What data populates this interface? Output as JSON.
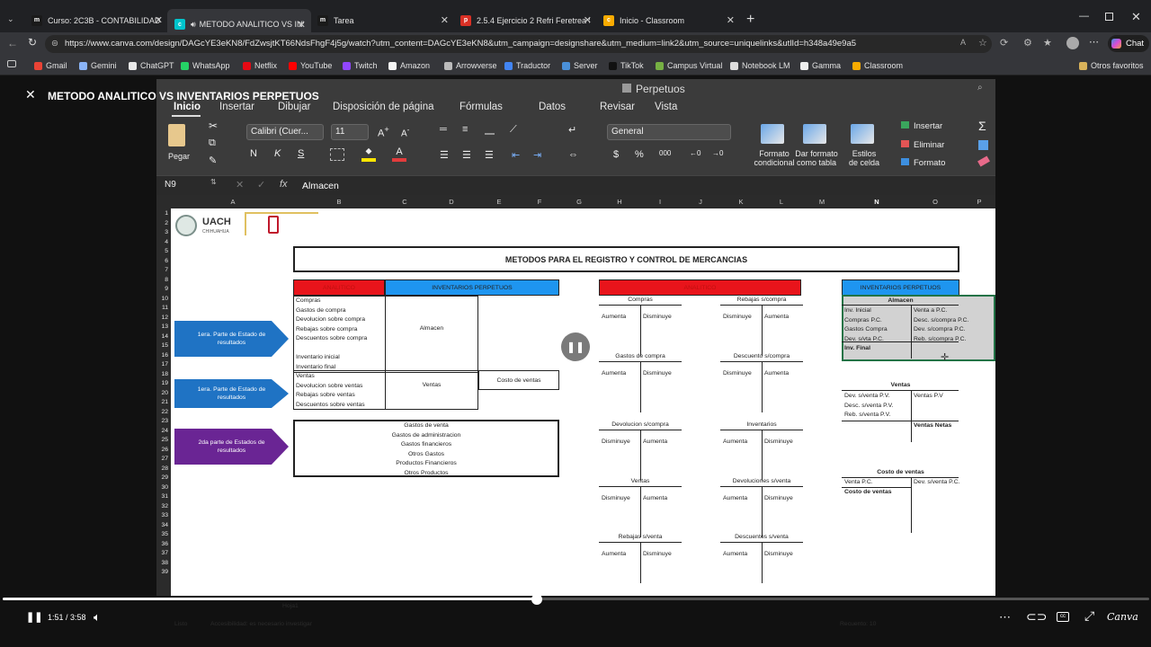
{
  "browser": {
    "tabs": [
      {
        "title": "Curso: 2C3B - CONTABILIDAD II - S",
        "fav": "m",
        "favcolor": "#1a1a1a"
      },
      {
        "title": "METODO ANALITICO VS INVE",
        "fav": "c",
        "favcolor": "#00c4cc"
      },
      {
        "title": "Tarea",
        "fav": "m",
        "favcolor": "#1a1a1a"
      },
      {
        "title": "2.5.4 Ejercicio 2 Refri Feretrea S.A",
        "fav": "p",
        "favcolor": "#d93025"
      },
      {
        "title": "Inicio - Classroom",
        "fav": "c",
        "favcolor": "#f9ab00"
      }
    ],
    "new_tab": "+",
    "url": "https://www.canva.com/design/DAGcYE3eKN8/FdZwsjtKT66NdsFhgF4j5g/watch?utm_content=DAGcYE3eKN8&utm_campaign=designshare&utm_medium=link2&utm_source=uniquelinks&utlId=h348a49e9a5",
    "chat_label": "Chat",
    "bookmarks": [
      {
        "label": "Gmail",
        "color": "#ea4335"
      },
      {
        "label": "Gemini",
        "color": "#8ab4f8"
      },
      {
        "label": "ChatGPT",
        "color": "#e8e8e8"
      },
      {
        "label": "WhatsApp",
        "color": "#25d366"
      },
      {
        "label": "Netflix",
        "color": "#e50914"
      },
      {
        "label": "YouTube",
        "color": "#ff0000"
      },
      {
        "label": "Twitch",
        "color": "#9146ff"
      },
      {
        "label": "Amazon",
        "color": "#f5f5f5"
      },
      {
        "label": "Arrowverse",
        "color": "#bbbbbb"
      },
      {
        "label": "Traductor",
        "color": "#4285f4"
      },
      {
        "label": "Server",
        "color": "#4a90d9"
      },
      {
        "label": "TikTok",
        "color": "#111111"
      },
      {
        "label": "Campus Virtual",
        "color": "#76b043"
      },
      {
        "label": "Notebook LM",
        "color": "#dddddd"
      },
      {
        "label": "Gamma",
        "color": "#eeeeee"
      },
      {
        "label": "Classroom",
        "color": "#f9ab00"
      }
    ],
    "other_favorites": "Otros favoritos"
  },
  "player": {
    "title": "METODO ANALITICO VS INVENTARIOS PERPETUOS",
    "time": "1:51 / 3:58",
    "progress": 0.466,
    "brand": "Canva",
    "blurred_status": "Listo",
    "blurred_accessibility": "Accesibilidad: es necesario investigar",
    "blurred_count": "Recuento: 10"
  },
  "excel": {
    "filename": "Perpetuos",
    "tabs": [
      "Inicio",
      "Insertar",
      "Dibujar",
      "Disposición de página",
      "Fórmulas",
      "Datos",
      "Revisar",
      "Vista"
    ],
    "paste": "Pegar",
    "font": "Calibri (Cuer...",
    "size": "11",
    "font_buttons": [
      "N",
      "K",
      "S"
    ],
    "number_format": "General",
    "num_symbols": [
      "$",
      "%",
      "000"
    ],
    "styles": [
      {
        "l1": "Formato",
        "l2": "condicional"
      },
      {
        "l1": "Dar formato",
        "l2": "como tabla"
      },
      {
        "l1": "Estilos",
        "l2": "de celda"
      }
    ],
    "cells_group": [
      "Insertar",
      "Eliminar",
      "Formato"
    ],
    "namebox": "N9",
    "formula": "Almacen",
    "columns": [
      "A",
      "B",
      "C",
      "D",
      "E",
      "F",
      "G",
      "H",
      "I",
      "J",
      "K",
      "L",
      "M",
      "N",
      "O",
      "P"
    ],
    "rows": [
      "1",
      "2",
      "3",
      "4",
      "5",
      "6",
      "7",
      "8",
      "9",
      "10",
      "11",
      "12",
      "13",
      "14",
      "15",
      "16",
      "17",
      "18",
      "19",
      "20",
      "21",
      "22",
      "23",
      "24",
      "25",
      "26",
      "27",
      "28",
      "29",
      "30",
      "31",
      "32",
      "33",
      "34",
      "35",
      "36",
      "37",
      "38",
      "39"
    ],
    "logo_uach": "UACH",
    "logo_uach_sub": "CHIHUAHUA",
    "main_title": "METODOS PARA EL REGISTRO Y CONTROL DE MERCANCIAS",
    "hdr_analitico": "ANALITICO",
    "hdr_perpetuos": "INVENTARIOS PERPETUOS",
    "arrows": [
      "1era. Parte de Estado de resultados",
      "1era. Parte de Estado de resultados",
      "2da parte de Estados de resultados"
    ],
    "list_a": [
      "Compras",
      "Gastos de compra",
      "Devolucion sobre compra",
      "Rebajas sobre compra",
      "Descuentos sobre compra",
      "",
      "Inventario inicial",
      "Inventario final"
    ],
    "almacen": "Almacen",
    "list_b": [
      "Ventas",
      "Devolucion sobre ventas",
      "Rebajas sobre ventas",
      "Descuentos sobre ventas"
    ],
    "ventas": "Ventas",
    "costo_ventas": "Costo de ventas",
    "list_c": [
      "Gastos de venta",
      "Gastos de administracion",
      "Gastos financieros",
      "Otros Gastos",
      "Productos Financieros",
      "Otros Productos"
    ],
    "taccounts": [
      {
        "name": "Compras",
        "left": "Aumenta",
        "right": "Disminuye"
      },
      {
        "name": "Rebajas s/compra",
        "left": "Disminuye",
        "right": "Aumenta"
      },
      {
        "name": "Gastos de compra",
        "left": "Aumenta",
        "right": "Disminuye"
      },
      {
        "name": "Descuento s/compra",
        "left": "Disminuye",
        "right": "Aumenta"
      },
      {
        "name": "Devolucion s/compra",
        "left": "Disminuye",
        "right": "Aumenta"
      },
      {
        "name": "Inventarios",
        "left": "Aumenta",
        "right": "Disminuye"
      },
      {
        "name": "Ventas",
        "left": "Disminuye",
        "right": "Aumenta"
      },
      {
        "name": "Devoluciones s/venta",
        "left": "Aumenta",
        "right": "Disminuye"
      },
      {
        "name": "Rebajas s/venta",
        "left": "Aumenta",
        "right": "Disminuye"
      },
      {
        "name": "Descuentos s/venta",
        "left": "Aumenta",
        "right": "Disminuye"
      }
    ],
    "perp_almacen": {
      "title": "Almacen",
      "left": [
        "Inv. Inicial",
        "Compras P.C.",
        "Gastos Compra",
        "Dev. s/vta P.C.",
        "Inv. Final"
      ],
      "right": [
        "Venta a P.C.",
        "Desc. s/compra P.C.",
        "Dev. s/compra P.C.",
        "Reb. s/compra P.C."
      ]
    },
    "perp_ventas": {
      "title": "Ventas",
      "left": [
        "Dev. s/venta P.V.",
        "Desc. s/venta P.V.",
        "Reb. s/venta P.V."
      ],
      "right": [
        "Ventas P.V",
        "Ventas Netas"
      ]
    },
    "perp_costo": {
      "title": "Costo de ventas",
      "left": [
        "Venta P.C.",
        "Costo de ventas"
      ],
      "right": [
        "Dev. s/venta P.C."
      ]
    },
    "sheet_tab": "Hoja1"
  }
}
